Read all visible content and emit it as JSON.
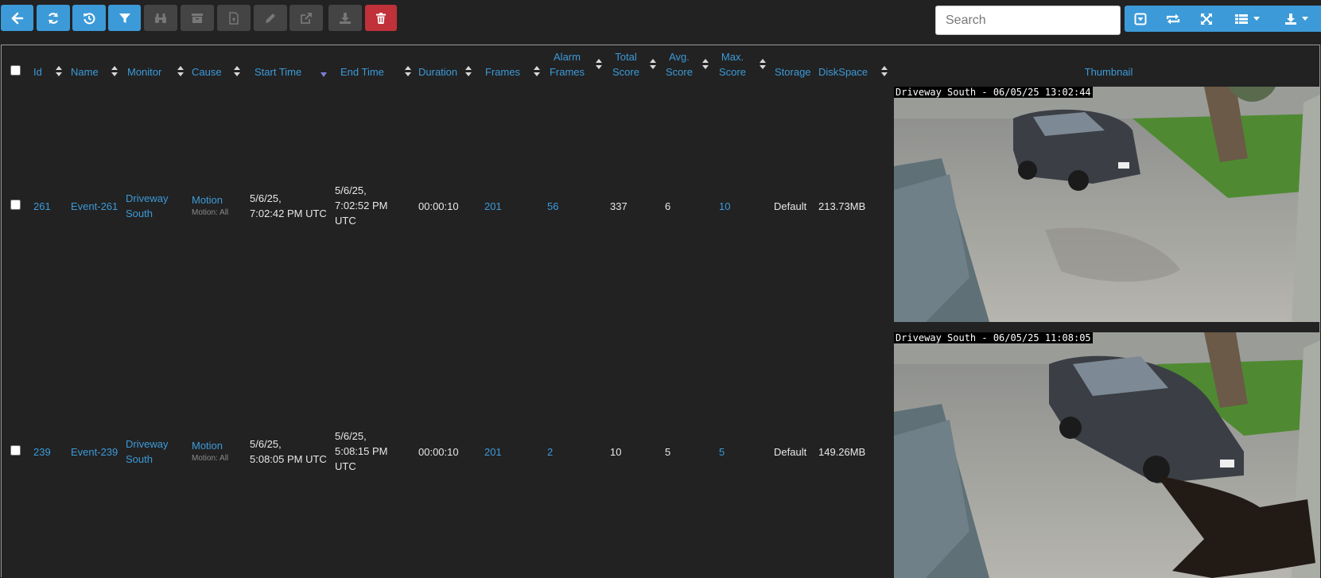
{
  "toolbar": {
    "buttons": [
      {
        "name": "back-button",
        "icon": "arrow-left-icon",
        "state": "enabled"
      },
      {
        "name": "refresh-button",
        "icon": "refresh-icon",
        "state": "enabled"
      },
      {
        "name": "history-button",
        "icon": "history-icon",
        "state": "enabled"
      },
      {
        "name": "filter-button",
        "icon": "filter-icon",
        "state": "enabled"
      },
      {
        "name": "view-button",
        "icon": "binoculars-icon",
        "state": "disabled"
      },
      {
        "name": "archive-button",
        "icon": "archive-icon",
        "state": "disabled"
      },
      {
        "name": "unarchive-button",
        "icon": "file-icon",
        "state": "disabled"
      },
      {
        "name": "edit-button",
        "icon": "pencil-icon",
        "state": "disabled"
      },
      {
        "name": "export-button",
        "icon": "external-link-icon",
        "state": "disabled"
      },
      {
        "name": "download-button",
        "icon": "download-icon",
        "state": "disabled"
      },
      {
        "name": "delete-button",
        "icon": "trash-icon",
        "state": "danger"
      }
    ],
    "search_placeholder": "Search",
    "right_buttons": [
      {
        "name": "toggle-button",
        "icon": "caret-square-icon"
      },
      {
        "name": "auto-refresh-button",
        "icon": "sync-icon"
      },
      {
        "name": "fullscreen-button",
        "icon": "expand-icon"
      },
      {
        "name": "columns-button",
        "icon": "list-icon"
      },
      {
        "name": "export-data-button",
        "icon": "download-icon"
      }
    ]
  },
  "table": {
    "headers": {
      "id": "Id",
      "name": "Name",
      "monitor": "Monitor",
      "cause": "Cause",
      "start_time": "Start Time",
      "end_time": "End Time",
      "duration": "Duration",
      "frames": "Frames",
      "alarm_frames_1": "Alarm",
      "alarm_frames_2": "Frames",
      "total_score_1": "Total",
      "total_score_2": "Score",
      "avg_score_1": "Avg.",
      "avg_score_2": "Score",
      "max_score_1": "Max.",
      "max_score_2": "Score",
      "storage": "Storage",
      "diskspace": "DiskSpace",
      "thumbnail": "Thumbnail"
    },
    "rows": [
      {
        "id": "261",
        "name": "Event-261",
        "monitor_1": "Driveway",
        "monitor_2": "South",
        "cause": "Motion",
        "cause_detail": "Motion: All",
        "start_1": "5/6/25,",
        "start_2": "7:02:42 PM UTC",
        "end_1": "5/6/25,",
        "end_2": "7:02:52 PM",
        "end_3": "UTC",
        "duration": "00:00:10",
        "frames": "201",
        "alarm_frames": "56",
        "total_score": "337",
        "avg_score": "6",
        "max_score": "10",
        "storage": "Default",
        "diskspace": "213.73MB",
        "thumb_overlay": "Driveway South - 06/05/25 13:02:44"
      },
      {
        "id": "239",
        "name": "Event-239",
        "monitor_1": "Driveway",
        "monitor_2": "South",
        "cause": "Motion",
        "cause_detail": "Motion: All",
        "start_1": "5/6/25,",
        "start_2": "5:08:05 PM UTC",
        "end_1": "5/6/25,",
        "end_2": "5:08:15 PM",
        "end_3": "UTC",
        "duration": "00:00:10",
        "frames": "201",
        "alarm_frames": "2",
        "total_score": "10",
        "avg_score": "5",
        "max_score": "5",
        "storage": "Default",
        "diskspace": "149.26MB",
        "thumb_overlay": "Driveway South - 06/05/25 11:08:05"
      }
    ]
  }
}
